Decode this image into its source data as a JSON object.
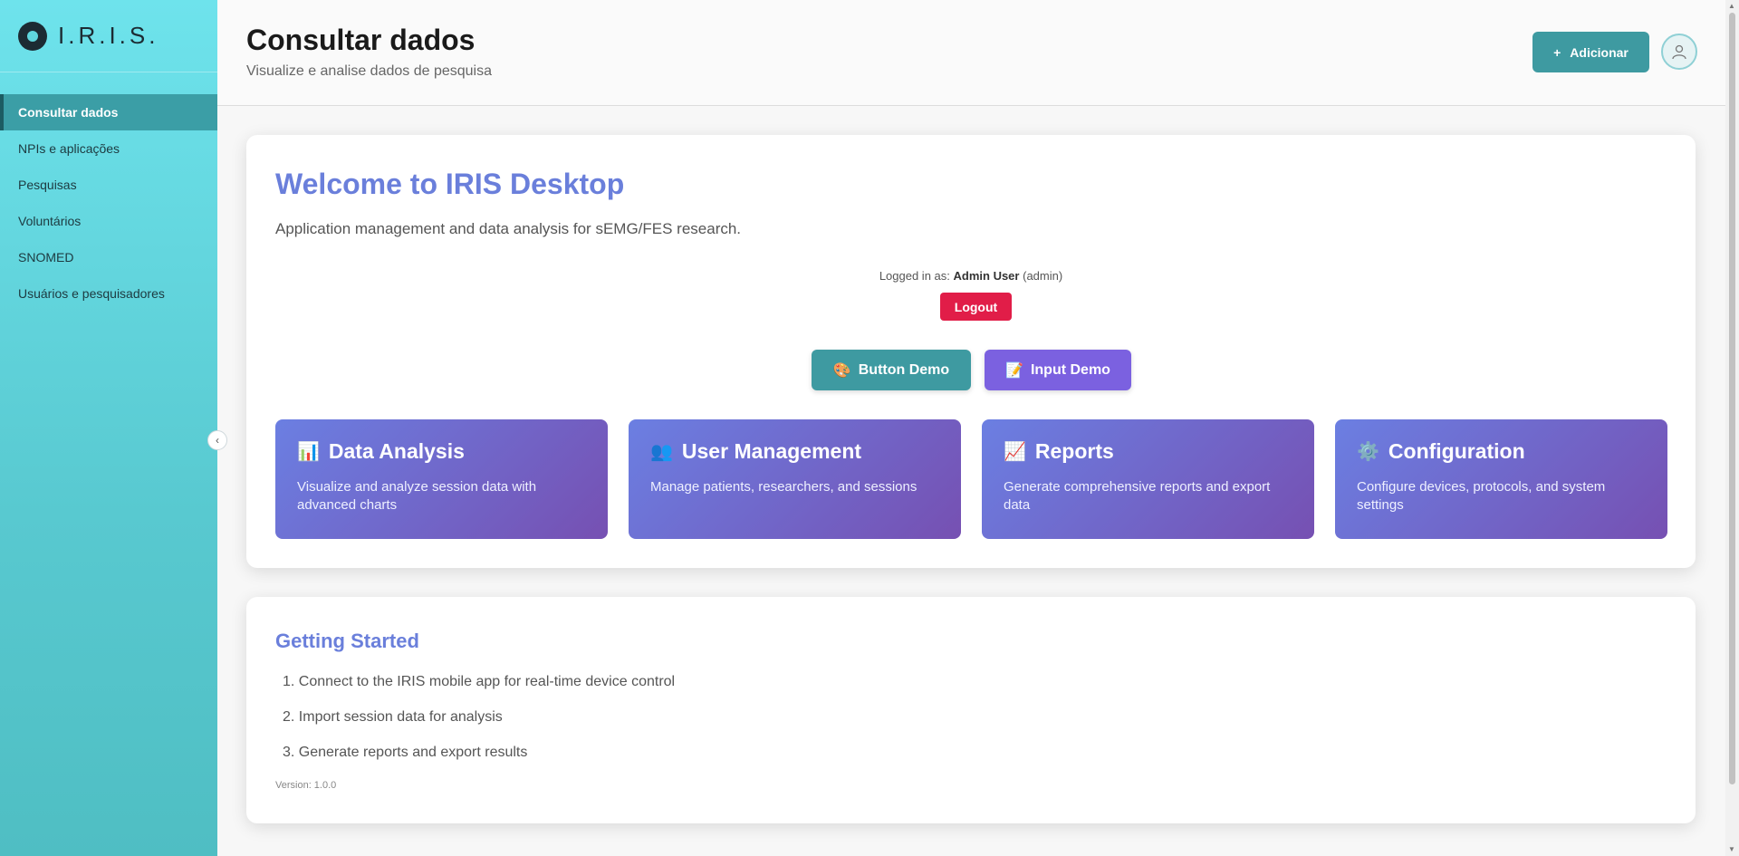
{
  "app": {
    "logo_text": "I.R.I.S."
  },
  "sidebar": {
    "items": [
      {
        "label": "Consultar dados",
        "active": true
      },
      {
        "label": "NPIs e aplicações"
      },
      {
        "label": "Pesquisas"
      },
      {
        "label": "Voluntários"
      },
      {
        "label": "SNOMED"
      },
      {
        "label": "Usuários e pesquisadores"
      }
    ],
    "collapse_icon": "‹"
  },
  "header": {
    "title": "Consultar dados",
    "subtitle": "Visualize e analise dados de pesquisa",
    "add_label": "Adicionar",
    "add_icon": "+"
  },
  "welcome": {
    "title": "Welcome to IRIS Desktop",
    "description": "Application management and data analysis for sEMG/FES research.",
    "logged_prefix": "Logged in as:",
    "user_name": "Admin User",
    "user_role": "(admin)",
    "logout_label": "Logout",
    "button_demo_label": "Button Demo",
    "button_demo_icon": "🎨",
    "input_demo_label": "Input Demo",
    "input_demo_icon": "📝",
    "features": [
      {
        "icon": "📊",
        "title": "Data Analysis",
        "desc": "Visualize and analyze session data with advanced charts"
      },
      {
        "icon": "👥",
        "title": "User Management",
        "desc": "Manage patients, researchers, and sessions"
      },
      {
        "icon": "📈",
        "title": "Reports",
        "desc": "Generate comprehensive reports and export data"
      },
      {
        "icon": "⚙️",
        "title": "Configuration",
        "desc": "Configure devices, protocols, and system settings"
      }
    ]
  },
  "getting_started": {
    "title": "Getting Started",
    "steps": [
      "1. Connect to the IRIS mobile app for real-time device control",
      "2. Import session data for analysis",
      "3. Generate reports and export results"
    ],
    "version": "Version: 1.0.0"
  },
  "colors": {
    "accent": "#3e9aa1",
    "title_blue": "#6a7fdb",
    "logout_red": "#e11d48",
    "purple": "#7b61e0"
  }
}
